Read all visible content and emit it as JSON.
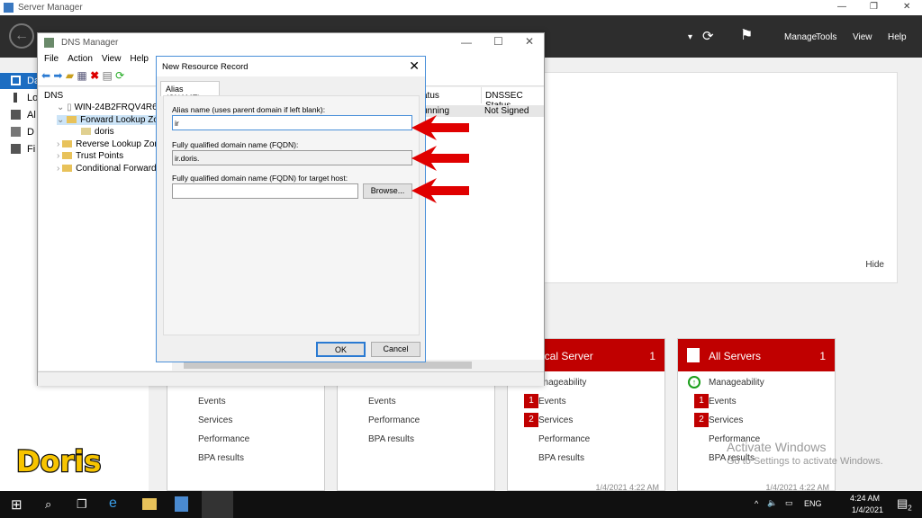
{
  "window": {
    "title": "Server Manager"
  },
  "header": {
    "menu": [
      "Manage",
      "Tools",
      "View",
      "Help"
    ]
  },
  "sidebar": {
    "items": [
      {
        "label": "Da"
      },
      {
        "label": "Lo"
      },
      {
        "label": "Al"
      },
      {
        "label": "D"
      },
      {
        "label": "Fi"
      }
    ]
  },
  "hero": {
    "hide_label": "Hide"
  },
  "tiles": [
    {
      "title": "",
      "rows": [
        "Events",
        "Services",
        "Performance",
        "BPA results"
      ]
    },
    {
      "title": "",
      "rows": [
        "Events",
        "Performance",
        "BPA results"
      ]
    },
    {
      "title": "ocal Server",
      "count": "1",
      "rows": [
        {
          "label": "anageability"
        },
        {
          "label": "Events",
          "badge": "1"
        },
        {
          "label": "Services",
          "badge": "2"
        },
        {
          "label": "Performance"
        },
        {
          "label": "BPA results"
        }
      ],
      "timestamp": "1/4/2021 4:22 AM"
    },
    {
      "title": "All Servers",
      "count": "1",
      "rows": [
        {
          "label": "Manageability"
        },
        {
          "label": "Events",
          "badge": "1"
        },
        {
          "label": "Services",
          "badge": "2"
        },
        {
          "label": "Performance"
        },
        {
          "label": "BPA results"
        }
      ],
      "timestamp": "1/4/2021 4:22 AM"
    }
  ],
  "dns": {
    "title": "DNS Manager",
    "menu": [
      "File",
      "Action",
      "View",
      "Help"
    ],
    "tree": [
      "DNS",
      "WIN-24B2FRQV4R6",
      "Forward Lookup Zone",
      "doris",
      "Reverse Lookup Zone",
      "Trust Points",
      "Conditional Forwarde"
    ],
    "columns": [
      "atus",
      "DNSSEC Status"
    ],
    "row": [
      "unning",
      "Not Signed"
    ]
  },
  "dialog": {
    "title": "New Resource Record",
    "tab": "Alias (CNAME)",
    "alias_label": "Alias name (uses parent domain if left blank):",
    "alias_value": "ir",
    "fqdn_label": "Fully qualified domain name (FQDN):",
    "fqdn_value": "ir.doris.",
    "target_label": "Fully qualified domain name (FQDN) for target host:",
    "target_value": "",
    "browse": "Browse...",
    "ok": "OK",
    "cancel": "Cancel"
  },
  "watermark": {
    "line1": "Activate Windows",
    "line2": "Go to Settings to activate Windows.",
    "logo": "Doris"
  },
  "taskbar": {
    "lang": "ENG",
    "time": "4:24 AM",
    "date": "1/4/2021",
    "notifications": "2"
  },
  "colors": {
    "accent_red": "#c00000",
    "arrow": "#e00000",
    "header": "#2d2d2d"
  }
}
